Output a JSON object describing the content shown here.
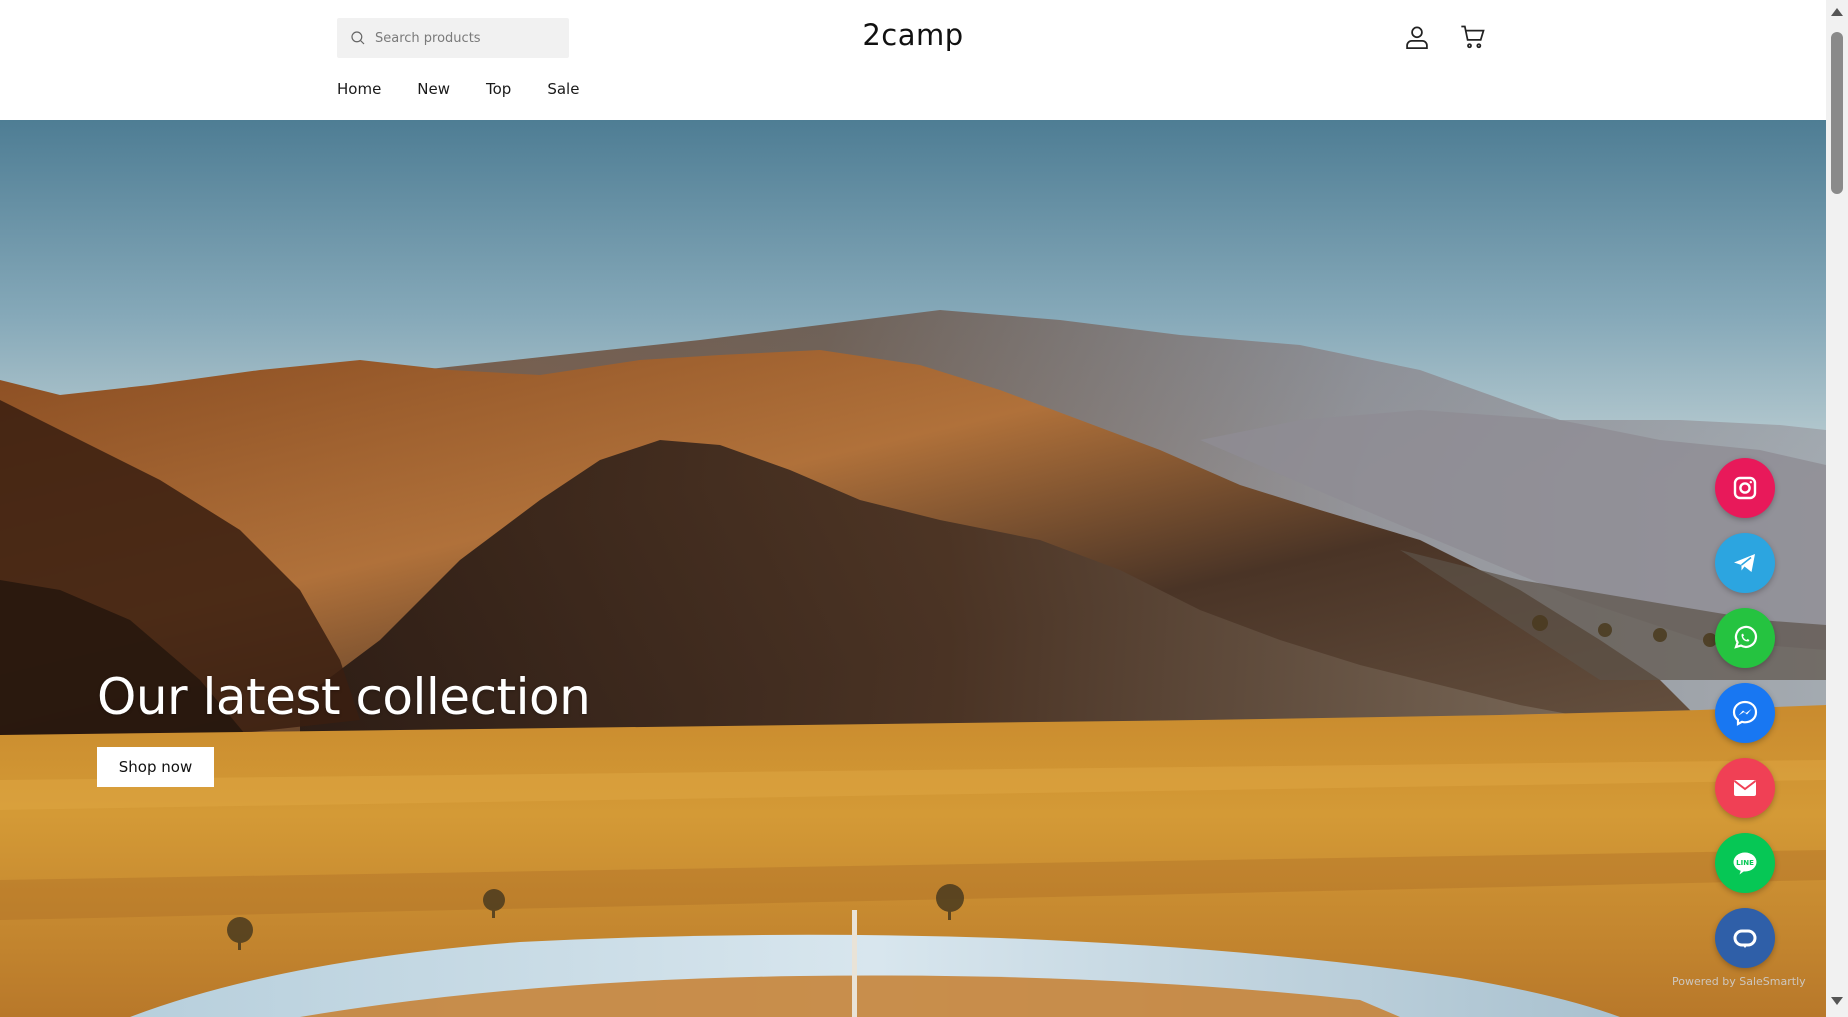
{
  "header": {
    "search": {
      "placeholder": "Search products"
    },
    "logo": "2camp",
    "nav": [
      "Home",
      "New",
      "Top",
      "Sale"
    ]
  },
  "hero": {
    "title": "Our latest collection",
    "button_label": "Shop now"
  },
  "social": {
    "buttons": [
      {
        "name": "instagram-icon",
        "color": "#e8195a"
      },
      {
        "name": "telegram-icon",
        "color": "#2ca5e0"
      },
      {
        "name": "whatsapp-icon",
        "color": "#25c340"
      },
      {
        "name": "messenger-icon",
        "color": "#1877f2"
      },
      {
        "name": "email-icon",
        "color": "#f04055"
      },
      {
        "name": "line-icon",
        "color": "#06c755"
      },
      {
        "name": "chat-icon",
        "color": "#2f5fa8"
      }
    ],
    "powered_by": "Powered by SaleSmartly"
  }
}
